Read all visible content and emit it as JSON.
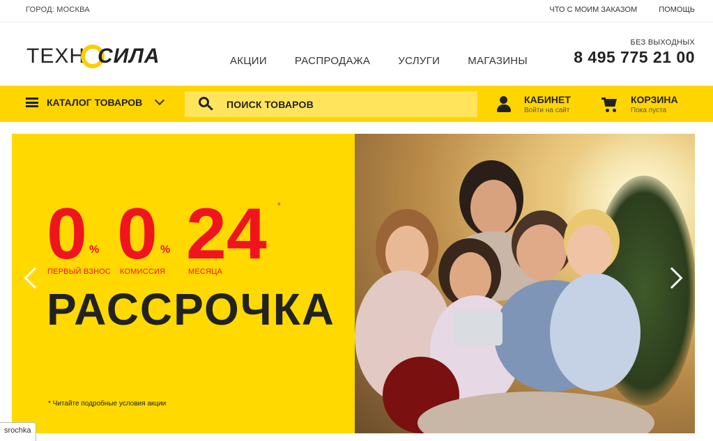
{
  "topbar": {
    "city": "ГОРОД: МОСКВА",
    "links": [
      "ЧТО С МОИМ ЗАКАЗОМ",
      "ПОМОЩЬ"
    ]
  },
  "header": {
    "logo_part1": "ТЕХН",
    "logo_part2": "СИЛА",
    "nav": [
      "АКЦИИ",
      "РАСПРОДАЖА",
      "УСЛУГИ",
      "МАГАЗИНЫ"
    ],
    "phone_note": "БЕЗ ВЫХОДНЫХ",
    "phone": "8 495 775 21 00"
  },
  "yellow_bar": {
    "catalog_label": "КАТАЛОГ ТОВАРОВ",
    "search_placeholder": "ПОИСК ТОВАРОВ",
    "cabinet_title": "КАБИНЕТ",
    "cabinet_sub": "Войти на сайт",
    "cart_title": "КОРЗИНА",
    "cart_sub": "Пока пуста"
  },
  "banner": {
    "item1_value": "0",
    "item1_unit": "%",
    "item1_label": "ПЕРВЫЙ ВЗНОС",
    "item2_value": "0",
    "item2_unit": "%",
    "item2_label": "КОМИССИЯ",
    "item3_value": "24",
    "item3_label": "МЕСЯЦА",
    "asterisk": "*",
    "headline": "РАССРОЧКА",
    "footnote": "* Читайте подробные условия акции"
  },
  "status_tooltip": "srochka",
  "colors": {
    "brand_yellow": "#ffd500",
    "accent_red": "#f0141e"
  }
}
